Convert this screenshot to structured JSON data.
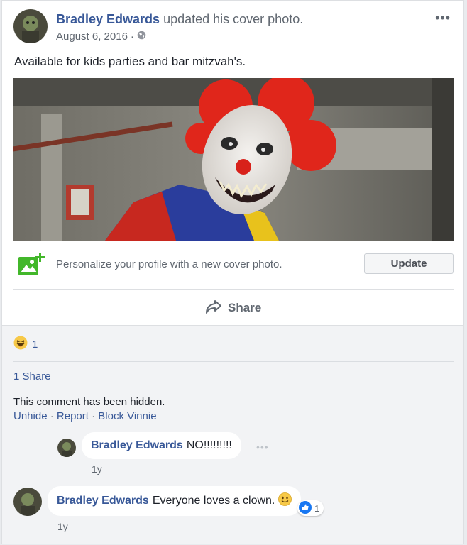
{
  "post": {
    "author": "Bradley Edwards",
    "action": "updated his cover photo.",
    "date": "August 6, 2016",
    "separator": "·",
    "audience_icon": "globe-icon",
    "more_icon": "ellipsis-icon",
    "more_label": "•••",
    "text": "Available for kids parties and bar mitzvah's."
  },
  "promo": {
    "icon": "add-photo-icon",
    "text": "Personalize your profile with a new cover photo.",
    "button_label": "Update"
  },
  "actions": {
    "share_icon": "share-arrow-icon",
    "share_label": "Share"
  },
  "footer": {
    "reaction_icon": "haha-emoji-icon",
    "reaction_count": "1",
    "shares": "1 Share",
    "hidden_comment": {
      "text": "This comment has been hidden.",
      "unhide": "Unhide",
      "report": "Report",
      "block": "Block Vinnie",
      "sep": "·"
    }
  },
  "comments": [
    {
      "author": "Bradley Edwards",
      "text": "NO!!!!!!!!!",
      "time": "1y",
      "menu_label": "•••"
    },
    {
      "author": "Bradley Edwards",
      "text": "Everyone loves a clown.",
      "emoji": "smiley-emoji-icon",
      "like_count": "1",
      "time": "1y"
    }
  ],
  "colors": {
    "link": "#385898",
    "secondary_text": "#606770",
    "footer_bg": "#f2f3f5",
    "promo_green": "#42b72a",
    "like_blue": "#1877f2"
  }
}
